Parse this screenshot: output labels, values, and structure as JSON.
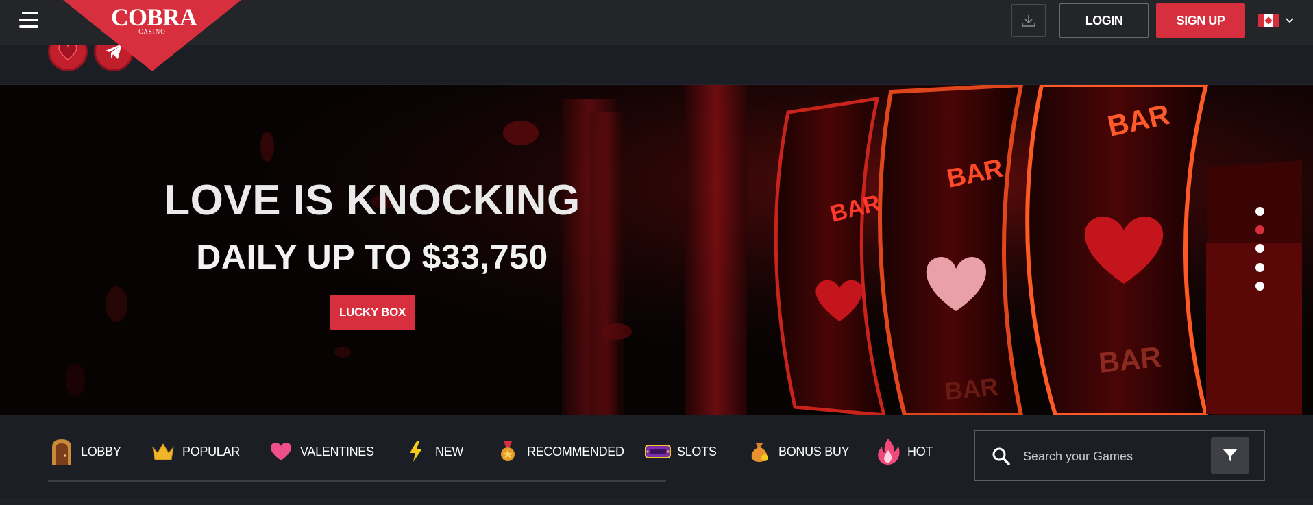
{
  "header": {
    "logo_text": "COBRA",
    "logo_subtext": "CASINO",
    "login_label": "LOGIN",
    "signup_label": "SIGN UP",
    "language_flag": "canada-flag-icon"
  },
  "hero": {
    "title": "LOVE IS KNOCKING",
    "subtitle": "DAILY UP TO $33,750",
    "cta_label": "LUCKY BOX",
    "slides_count": 5,
    "active_slide": 2
  },
  "categories": [
    {
      "label": "LOBBY",
      "icon": "lobby-door-icon"
    },
    {
      "label": "POPULAR",
      "icon": "crown-icon"
    },
    {
      "label": "VALENTINES",
      "icon": "heart-icon"
    },
    {
      "label": "NEW",
      "icon": "lightning-icon"
    },
    {
      "label": "RECOMMENDED",
      "icon": "medal-icon"
    },
    {
      "label": "SLOTS",
      "icon": "slot-sign-icon"
    },
    {
      "label": "BONUS BUY",
      "icon": "money-bag-icon"
    },
    {
      "label": "HOT",
      "icon": "fire-icon"
    }
  ],
  "search": {
    "placeholder": "Search your Games"
  },
  "colors": {
    "accent": "#d72f3e",
    "topbar": "#242528",
    "panel": "#1b1e24"
  }
}
